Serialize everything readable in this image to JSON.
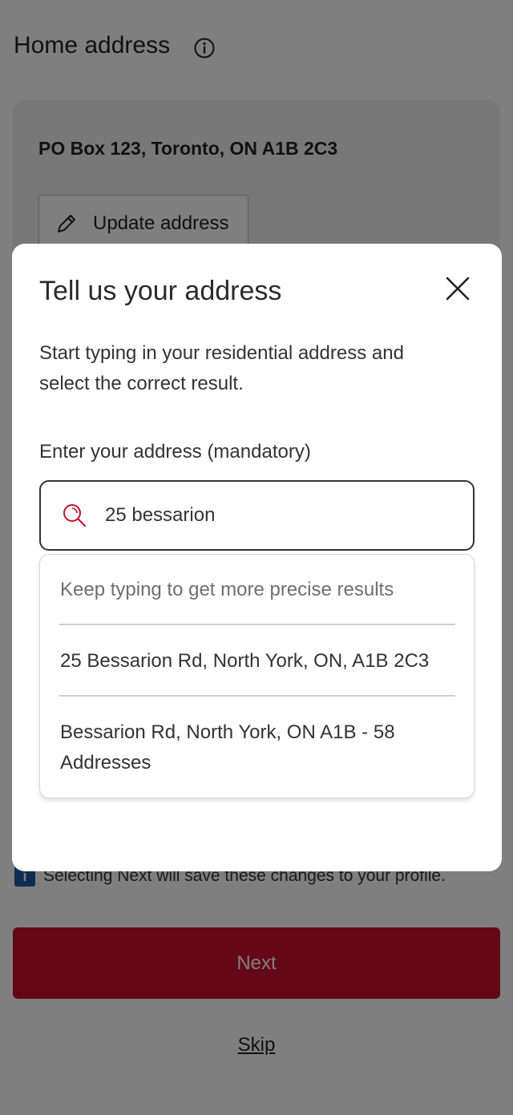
{
  "page": {
    "title": "Home address",
    "current_address": "PO Box 123, Toronto, ON A1B 2C3",
    "update_label": "Update address",
    "notice_text": "Selecting Next will save these changes to your profile.",
    "notice_badge": "i",
    "next_label": "Next",
    "skip_label": "Skip"
  },
  "modal": {
    "title": "Tell us your address",
    "description": "Start typing in your residential address and select the correct result.",
    "field_label": "Enter your address (mandatory)",
    "search_value": "25 bessarion",
    "hint": "Keep typing to get more precise results",
    "results": [
      "25 Bessarion Rd, North York, ON, A1B 2C3",
      "Bessarion Rd, North York, ON A1B - 58 Addresses"
    ]
  },
  "colors": {
    "brand_red": "#c8102e",
    "info_blue": "#1f5aa6"
  },
  "icons": [
    "info-icon",
    "pencil-icon",
    "close-icon",
    "search-icon"
  ]
}
